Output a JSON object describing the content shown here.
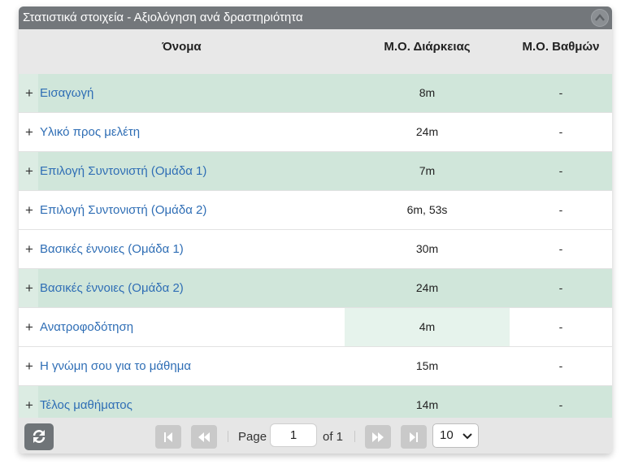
{
  "panel": {
    "title": "Στατιστικά στοιχεία - Αξιολόγηση ανά δραστηριότητα"
  },
  "columns": {
    "name": "Όνομα",
    "duration": "Μ.Ο. Διάρκειας",
    "grade": "Μ.Ο. Βαθμών"
  },
  "rows": [
    {
      "expand": "+",
      "name": "Εισαγωγή",
      "duration": "8m",
      "grade": "-"
    },
    {
      "expand": "+",
      "name": "Υλικό προς μελέτη",
      "duration": "24m",
      "grade": "-"
    },
    {
      "expand": "+",
      "name": "Επιλογή Συντονιστή (Ομάδα 1)",
      "duration": "7m",
      "grade": "-"
    },
    {
      "expand": "+",
      "name": "Επιλογή Συντονιστή (Ομάδα 2)",
      "duration": "6m, 53s",
      "grade": "-"
    },
    {
      "expand": "+",
      "name": "Βασικές έννοιες (Ομάδα 1)",
      "duration": "30m",
      "grade": "-"
    },
    {
      "expand": "+",
      "name": "Βασικές έννοιες (Ομάδα 2)",
      "duration": "24m",
      "grade": "-"
    },
    {
      "expand": "+",
      "name": "Ανατροφοδότηση",
      "duration": "4m",
      "grade": "-"
    },
    {
      "expand": "+",
      "name": "Η γνώμη σου για το μάθημα",
      "duration": "15m",
      "grade": "-"
    },
    {
      "expand": "+",
      "name": "Τέλος μαθήματος",
      "duration": "14m",
      "grade": "-"
    }
  ],
  "pager": {
    "page_label": "Page",
    "current_page": "1",
    "of_label": "of 1",
    "page_size": "10",
    "icons": {
      "refresh": "refresh-icon",
      "first": "first-page-icon",
      "prev": "prev-page-icon",
      "next": "next-page-icon",
      "last": "last-page-icon"
    }
  },
  "colors": {
    "title_bar": "#73777b",
    "header_bg": "#e8e8e8",
    "row_alt": "#d0e6da",
    "link": "#2f6eb5"
  }
}
